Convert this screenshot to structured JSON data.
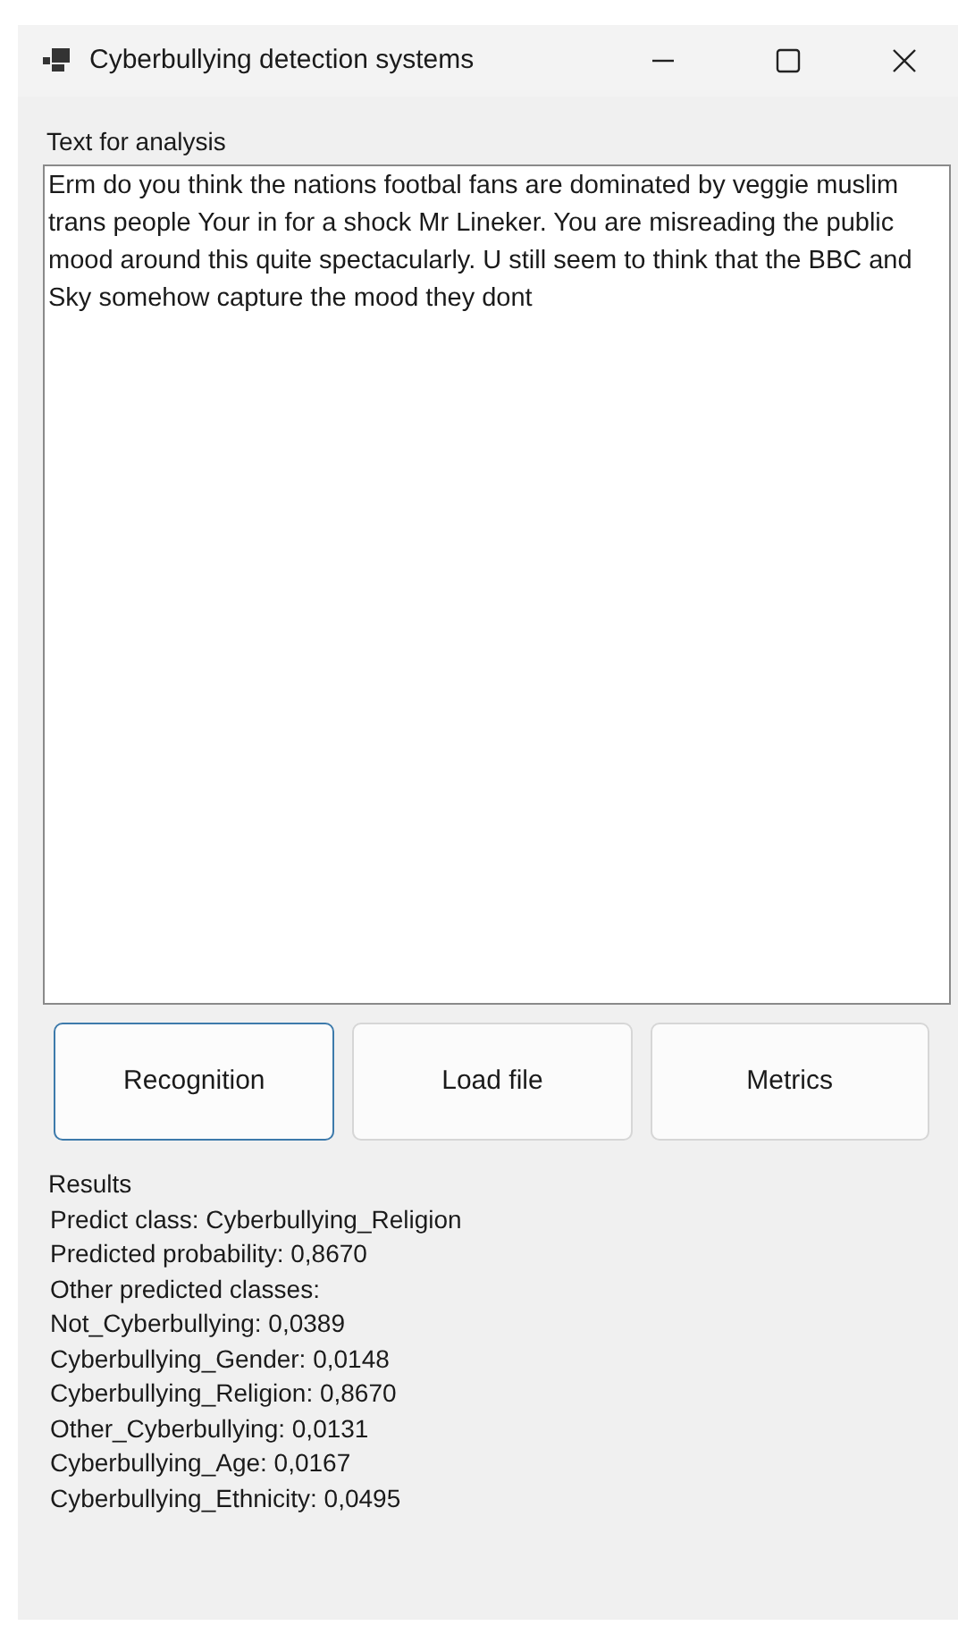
{
  "window": {
    "title": "Cyberbullying detection systems"
  },
  "input": {
    "label": "Text for analysis",
    "value": "Erm do you think the nations footbal fans are dominated by veggie muslim trans people Your in for a shock Mr Lineker. You are misreading the public mood around this quite spectacularly. U still seem to think that the BBC and Sky somehow capture the mood they dont"
  },
  "buttons": [
    {
      "label": "Recognition",
      "focused": true
    },
    {
      "label": "Load file",
      "focused": false
    },
    {
      "label": "Metrics",
      "focused": false
    }
  ],
  "results": {
    "heading": "Results",
    "lines": [
      "Predict class: Cyberbullying_Religion",
      "Predicted probability: 0,8670",
      "Other predicted classes:",
      "Not_Cyberbullying: 0,0389",
      "Cyberbullying_Gender: 0,0148",
      "Cyberbullying_Religion: 0,8670",
      "Other_Cyberbullying: 0,0131",
      "Cyberbullying_Age: 0,0167",
      "Cyberbullying_Ethnicity: 0,0495"
    ]
  }
}
